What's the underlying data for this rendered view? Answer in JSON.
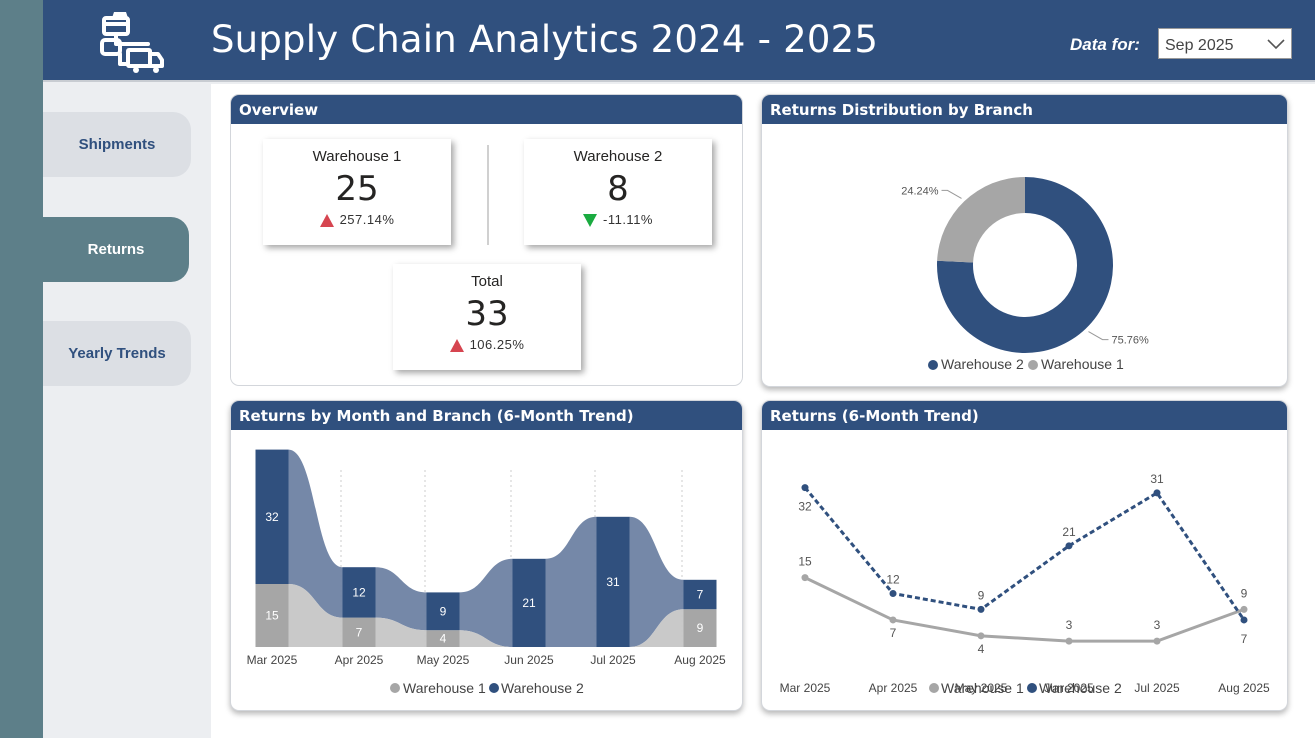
{
  "header": {
    "title": "Supply Chain Analytics 2024 - 2025",
    "data_for_label": "Data for:",
    "period_value": "Sep 2025",
    "logo_icon": "supply-chain-truck-logo"
  },
  "nav": {
    "items": [
      {
        "label": "Shipments",
        "active": false
      },
      {
        "label": "Returns",
        "active": true
      },
      {
        "label": "Yearly Trends",
        "active": false
      }
    ]
  },
  "overview": {
    "title": "Overview",
    "kpis": [
      {
        "label": "Warehouse 1",
        "value": "25",
        "change": "257.14%",
        "direction": "up"
      },
      {
        "label": "Warehouse 2",
        "value": "8",
        "change": "-11.11%",
        "direction": "down"
      },
      {
        "label": "Total",
        "value": "33",
        "change": "106.25%",
        "direction": "up"
      }
    ]
  },
  "colors": {
    "warehouse2": "#30507e",
    "warehouse1": "#a6a6a6",
    "up_arrow": "#d64550",
    "down_arrow": "#1aab40"
  },
  "donut": {
    "title": "Returns Distribution by Branch",
    "legend": [
      "Warehouse 2",
      "Warehouse 1"
    ]
  },
  "ribbon": {
    "title": "Returns by Month and Branch (6-Month Trend)",
    "legend": [
      "Warehouse 1",
      "Warehouse 2"
    ]
  },
  "line": {
    "title": "Returns (6-Month Trend)",
    "legend": [
      "Warehouse 1",
      "Warehouse 2"
    ]
  },
  "chart_data": [
    {
      "type": "pie",
      "title": "Returns Distribution by Branch",
      "categories": [
        "Warehouse 2",
        "Warehouse 1"
      ],
      "values": [
        75.76,
        24.24
      ],
      "labels": [
        "75.76%",
        "24.24%"
      ],
      "legend": "bottom"
    },
    {
      "type": "bar",
      "title": "Returns by Month and Branch (6-Month Trend)",
      "categories": [
        "Mar 2025",
        "Apr 2025",
        "May 2025",
        "Jun 2025",
        "Jul 2025",
        "Aug 2025"
      ],
      "series": [
        {
          "name": "Warehouse 1",
          "values": [
            15,
            7,
            4,
            0,
            0,
            9
          ]
        },
        {
          "name": "Warehouse 2",
          "values": [
            32,
            12,
            9,
            21,
            31,
            7
          ]
        }
      ],
      "legend": "bottom"
    },
    {
      "type": "line",
      "title": "Returns (6-Month Trend)",
      "categories": [
        "Mar 2025",
        "Apr 2025",
        "May 2025",
        "Jun 2025",
        "Jul 2025",
        "Aug 2025"
      ],
      "series": [
        {
          "name": "Warehouse 1",
          "values": [
            15,
            7,
            4,
            3,
            3,
            9
          ]
        },
        {
          "name": "Warehouse 2",
          "values": [
            32,
            12,
            9,
            21,
            31,
            7
          ]
        }
      ],
      "legend": "bottom"
    }
  ]
}
